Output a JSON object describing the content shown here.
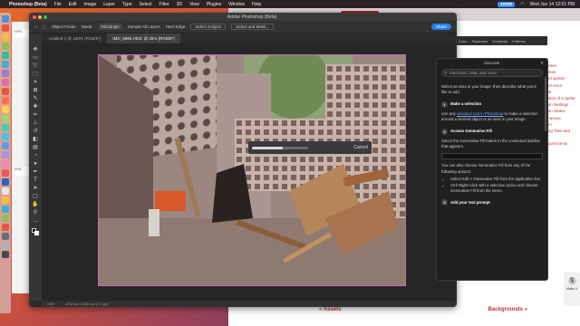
{
  "menubar": {
    "app": "Photoshop (Beta)",
    "items": [
      "File",
      "Edit",
      "Image",
      "Layer",
      "Type",
      "Select",
      "Filter",
      "3D",
      "View",
      "Plugins",
      "Window",
      "Help"
    ],
    "zoom_label": "zoom",
    "clock": "Wed Jun 14 12:51 PM"
  },
  "browser": {
    "tabs": [
      "SW Studio Tutorial 3: Sprites",
      "SW Studio 7 - Google Slides",
      "Sprites | SW Studio"
    ],
    "sidelist": [
      "Sprites",
      "sprites",
      "ated sprites",
      "ated Actor",
      "ditor",
      "osition of a Sprite",
      "ation Settings",
      "ation States",
      "s Canvas",
      "Skin",
      "ating Tiles and",
      "ns",
      "requirements"
    ],
    "footer_assets": "« Assets",
    "footer_backgrounds": "Backgrounds »"
  },
  "photoshop": {
    "title": "Adobe Photoshop (Beta)",
    "options": {
      "object_finder": "Object Finder",
      "mode_label": "Mode:",
      "mode_value": "Rectangle",
      "sample_all": "Sample All Layers",
      "hard_edge": "Hard Edge",
      "select_subject": "Select Subject",
      "select_mask": "Select and Mask...",
      "share": "Share"
    },
    "doc_tabs": [
      "Untitled-1 @ 100% (RGB/8*)",
      "IMG_8985.HEIC @ 25% (RGB/8*)"
    ],
    "status_zoom": "25%",
    "status_size": "4032 px x 3024 px (72 ppi)",
    "progress": {
      "fraction": 0.55,
      "cancel_label": "Cancel"
    },
    "panel_tabs": [
      "Color",
      "Swatches",
      "Gradients",
      "Patterns"
    ]
  },
  "discover": {
    "title": "Discover",
    "search_placeholder": "Find tools, help, and more",
    "intro": "Select an area in your image, then describe what you'd like to add.",
    "step1_title": "Make a selection",
    "step1_text_a": "Use any ",
    "step1_link": "selection tool in Photoshop",
    "step1_text_b": " to make a selection around a desired object or an area in your image.",
    "step2_title": "Access Generative Fill",
    "step2_text": "Select the Generative Fill button in the contextual taskbar that appears.",
    "step2_more": "You can also choose Generative Fill from any of the following options:",
    "bullet1": "Select Edit > Generative Fill from the application bar.",
    "bullet2": "Ctrl/ Right+click with a selection active and choose Generative Fill from the menu.",
    "step3_title": "Add your text prompt"
  },
  "zoom_bubble": {
    "label": "Make U"
  },
  "leftpanel": {
    "labels": [
      "SPEI",
      "AREI"
    ]
  }
}
